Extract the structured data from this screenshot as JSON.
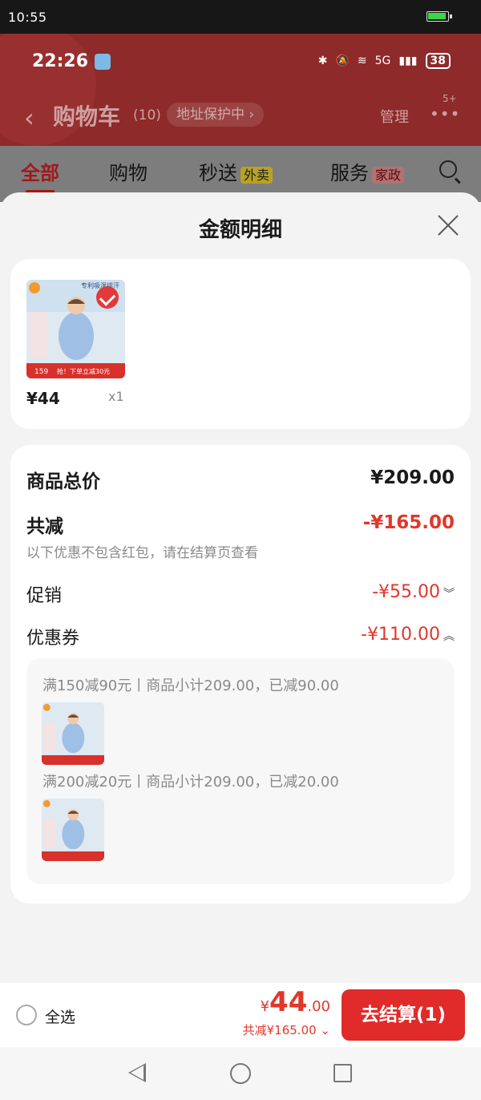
{
  "system": {
    "time": "10:55"
  },
  "inner_status": {
    "time": "22:26",
    "network": "5G",
    "battery": "38"
  },
  "header": {
    "title": "购物车",
    "count": "(10)",
    "address": "地址保护中 ›",
    "manage": "管理",
    "more_badge": "5+"
  },
  "tabs": [
    {
      "label": "全部"
    },
    {
      "label": "购物"
    },
    {
      "label": "秒送",
      "tag": "外卖"
    },
    {
      "label": "服务",
      "tag": "家政"
    }
  ],
  "sheet": {
    "title": "金额明细",
    "item": {
      "price": "¥44",
      "qty": "x1",
      "thumb_price": "159",
      "thumb_promo": "抢！下单立减30元",
      "thumb_headline": "专利吸湿排汗"
    },
    "summary": {
      "total_label": "商品总价",
      "total_value": "¥209.00",
      "discount_label": "共减",
      "discount_value": "-¥165.00",
      "discount_note": "以下优惠不包含红包，请在结算页查看",
      "promo_label": "促销",
      "promo_value": "-¥55.00",
      "coupon_label": "优惠券",
      "coupon_value": "-¥110.00"
    },
    "coupons": [
      {
        "text": "满150减90元丨商品小计209.00，已减90.00"
      },
      {
        "text": "满200减20元丨商品小计209.00，已减20.00"
      }
    ]
  },
  "bottom": {
    "select_all": "全选",
    "currency": "¥",
    "total_int": "44",
    "total_dec": ".00",
    "total_sub": "共减¥165.00 ⌄",
    "checkout": "去结算(1)"
  },
  "colors": {
    "accent": "#e1372b",
    "checkout": "#e12a2a",
    "header": "#8e2a2a"
  }
}
